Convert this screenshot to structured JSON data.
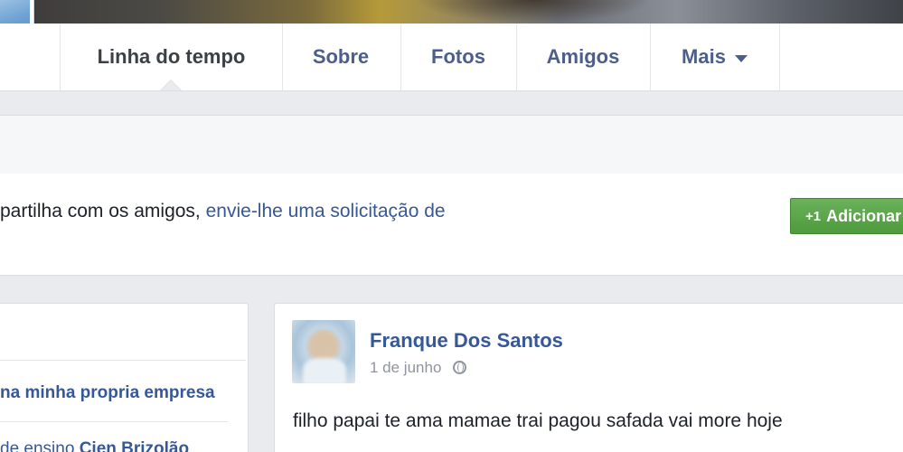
{
  "nav": {
    "tabs": [
      {
        "label": "Linha do tempo"
      },
      {
        "label": "Sobre"
      },
      {
        "label": "Fotos"
      },
      {
        "label": "Amigos"
      },
      {
        "label": "Mais"
      }
    ]
  },
  "friend_request": {
    "text": "partilha com os amigos,",
    "link": "envie-lhe uma solicitação de",
    "button_icon": "+1",
    "button_label": "Adicionar"
  },
  "left_column": {
    "link1": "na minha propria empresa",
    "link2_prefix": "de ensino",
    "link2_strong": "Cien Brizolão"
  },
  "post": {
    "author": "Franque Dos Santos",
    "date": "1 de junho",
    "privacy_icon": "globe-icon",
    "text": "filho papai te ama mamae trai pagou safada vai more hoje"
  },
  "colors": {
    "link_blue": "#365899",
    "add_button_green": "#5ba84a",
    "background": "#e9ebee"
  }
}
